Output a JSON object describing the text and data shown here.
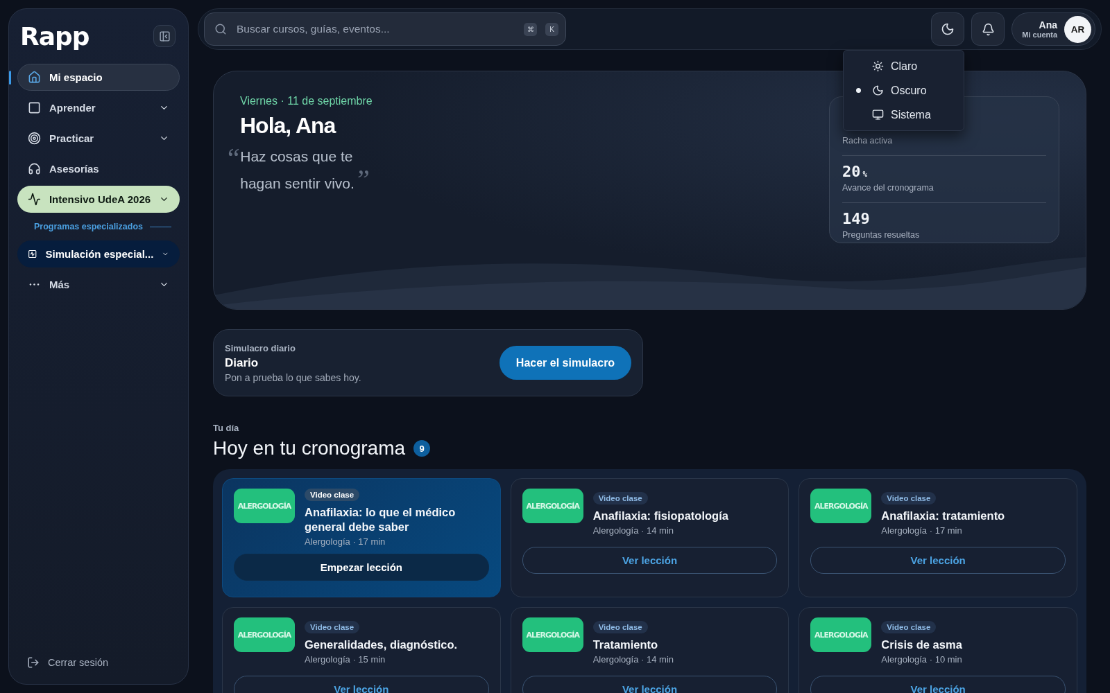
{
  "sidebar": {
    "logo": "Rapp",
    "items": [
      {
        "kind": "link",
        "label": "Mi espacio",
        "selected": true,
        "expandable": false
      },
      {
        "kind": "link",
        "label": "Aprender",
        "selected": false,
        "expandable": true
      },
      {
        "kind": "link",
        "label": "Practicar",
        "selected": false,
        "expandable": true
      },
      {
        "kind": "link",
        "label": "Asesorías",
        "selected": false,
        "expandable": false
      },
      {
        "kind": "accent",
        "label": "Intensivo UdeA 2026",
        "selected": false,
        "expandable": true
      },
      {
        "kind": "section",
        "label": "Programas especializados"
      },
      {
        "kind": "program",
        "label": "Simulación especial...",
        "selected": false,
        "expandable": true
      },
      {
        "kind": "link",
        "label": "Más",
        "selected": false,
        "expandable": true
      }
    ],
    "logout": "Cerrar sesión"
  },
  "topbar": {
    "search": {
      "placeholder": "Buscar cursos, guías, eventos...",
      "keys": [
        "⌘",
        "K"
      ]
    },
    "account": {
      "name": "Ana",
      "subtitle": "Mi cuenta",
      "initials": "AR"
    },
    "theme_menu": [
      {
        "label": "Claro",
        "selected": false
      },
      {
        "label": "Oscuro",
        "selected": true
      },
      {
        "label": "Sistema",
        "selected": false
      }
    ]
  },
  "hero": {
    "date": "Viernes · 11 de septiembre",
    "greeting": "Hola, Ana",
    "quote": "Haz cosas que te hagan sentir vivo.",
    "open_quote": "“",
    "close_quote": "”",
    "stats": [
      {
        "label": "Racha activa"
      },
      {
        "value": "20",
        "unit": "%",
        "label": "Avance del cronograma"
      },
      {
        "value": "149",
        "label": "Preguntas resueltas"
      }
    ]
  },
  "daily": {
    "eyebrow": "Simulacro diario",
    "title": "Diario",
    "subtitle": "Pon a prueba lo que sabes hoy.",
    "button": "Hacer el simulacro"
  },
  "today": {
    "eyebrow": "Tu día",
    "title": "Hoy en tu cronograma",
    "count": "9",
    "lessons": [
      {
        "thumb": "ALERGOLOGÍA",
        "badge": "Video clase",
        "title": "Anafilaxia: lo que el médico general debe saber",
        "meta": "Alergología · 17 min",
        "button": "Empezar lección",
        "featured": true
      },
      {
        "thumb": "ALERGOLOGÍA",
        "badge": "Video clase",
        "title": "Anafilaxia: fisiopatología",
        "meta": "Alergología · 14 min",
        "button": "Ver lección",
        "featured": false
      },
      {
        "thumb": "ALERGOLOGÍA",
        "badge": "Video clase",
        "title": "Anafilaxia: tratamiento",
        "meta": "Alergología · 17 min",
        "button": "Ver lección",
        "featured": false
      },
      {
        "thumb": "ALERGOLOGÍA",
        "badge": "Video clase",
        "title": "Generalidades, diagnóstico.",
        "meta": "Alergología · 15 min",
        "button": "Ver lección",
        "featured": false
      },
      {
        "thumb": "ALERGOLOGÍA",
        "badge": "Video clase",
        "title": "Tratamiento",
        "meta": "Alergología · 14 min",
        "button": "Ver lección",
        "featured": false
      },
      {
        "thumb": "ALERGOLOGÍA",
        "badge": "Video clase",
        "title": "Crisis de asma",
        "meta": "Alergología · 10 min",
        "button": "Ver lección",
        "featured": false
      }
    ]
  }
}
